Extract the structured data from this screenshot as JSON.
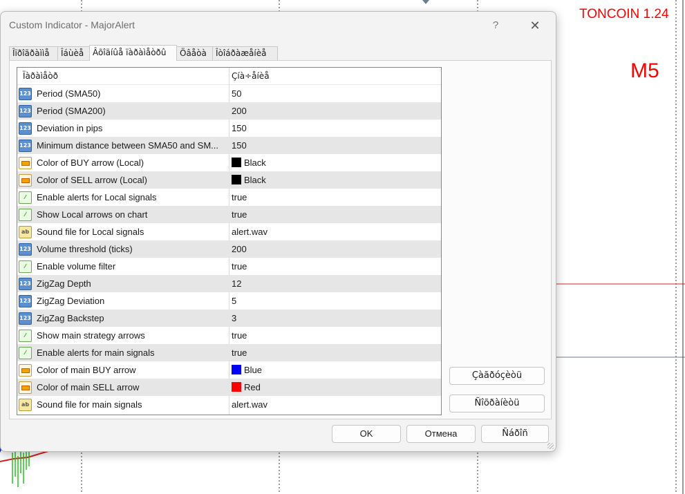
{
  "chart": {
    "symbol_label": "TONCOIN 1.24",
    "timeframe_label": "M5",
    "label_color": "#ff0000"
  },
  "dialog": {
    "title": "Custom Indicator - MajorAlert",
    "help_glyph": "?",
    "close_glyph": "✕",
    "tabs": [
      {
        "label": "Îïðîãðàììå"
      },
      {
        "label": "Îáùèå"
      },
      {
        "label": "Âõîäíûå ïàðàìåòðû",
        "active": true
      },
      {
        "label": "Öâåòà"
      },
      {
        "label": "Îòîáðàæåíèå"
      }
    ],
    "grid": {
      "header_name": "Ïàðàìåòð",
      "header_value": "Çíà÷åíèå",
      "rows": [
        {
          "icon": "number-icon",
          "name": "Period (SMA50)",
          "value": "50"
        },
        {
          "icon": "number-icon",
          "name": "Period (SMA200)",
          "value": "200"
        },
        {
          "icon": "number-icon",
          "name": "Deviation in pips",
          "value": "150"
        },
        {
          "icon": "number-icon",
          "name": "Minimum distance between SMA50 and SM...",
          "value": "150"
        },
        {
          "icon": "color-icon",
          "name": "Color of BUY arrow (Local)",
          "value": "Black",
          "swatch": "#000000"
        },
        {
          "icon": "color-icon",
          "name": "Color of SELL arrow (Local)",
          "value": "Black",
          "swatch": "#000000"
        },
        {
          "icon": "bool-icon",
          "name": "Enable alerts for Local signals",
          "value": "true"
        },
        {
          "icon": "bool-icon",
          "name": "Show Local arrows on chart",
          "value": "true"
        },
        {
          "icon": "string-icon",
          "name": "Sound file for Local signals",
          "value": "alert.wav"
        },
        {
          "icon": "number-icon",
          "name": "Volume threshold (ticks)",
          "value": "200"
        },
        {
          "icon": "bool-icon",
          "name": "Enable volume filter",
          "value": "true"
        },
        {
          "icon": "number-icon",
          "name": "ZigZag Depth",
          "value": "12"
        },
        {
          "icon": "number-icon",
          "name": "ZigZag Deviation",
          "value": "5"
        },
        {
          "icon": "number-icon",
          "name": "ZigZag Backstep",
          "value": "3"
        },
        {
          "icon": "bool-icon",
          "name": "Show main strategy arrows",
          "value": "true"
        },
        {
          "icon": "bool-icon",
          "name": "Enable alerts for main signals",
          "value": "true"
        },
        {
          "icon": "color-icon",
          "name": "Color of main BUY arrow",
          "value": "Blue",
          "swatch": "#0000ff"
        },
        {
          "icon": "color-icon",
          "name": "Color of main SELL arrow",
          "value": "Red",
          "swatch": "#ff0000"
        },
        {
          "icon": "string-icon",
          "name": "Sound file for main signals",
          "value": "alert.wav"
        }
      ]
    },
    "side_buttons": {
      "load_label": "Çàãðóçèòü",
      "save_label": "Ñîõðàíèòü"
    },
    "footer_buttons": {
      "ok_label": "OK",
      "cancel_label": "Отмена",
      "reset_label": "Ñáðîñ"
    }
  }
}
